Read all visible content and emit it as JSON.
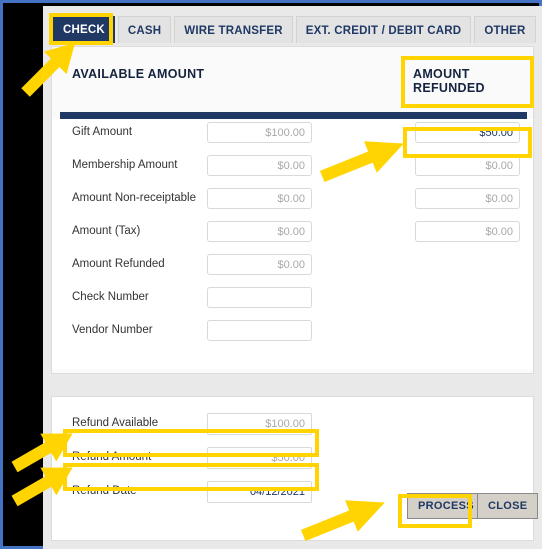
{
  "window": {
    "frame_color": "#4472c4",
    "highlight_color": "#ffd400",
    "accent_color": "#1f3864"
  },
  "tabs": [
    {
      "label": "CHECK",
      "active": true,
      "highlighted": true
    },
    {
      "label": "CASH",
      "active": false,
      "highlighted": false
    },
    {
      "label": "WIRE TRANSFER",
      "active": false,
      "highlighted": false
    },
    {
      "label": "EXT. CREDIT / DEBIT CARD",
      "active": false,
      "highlighted": false
    },
    {
      "label": "OTHER",
      "active": false,
      "highlighted": false
    }
  ],
  "headings": {
    "available_amount": "AVAILABLE AMOUNT",
    "amount_refunded": "AMOUNT REFUNDED"
  },
  "fields": [
    {
      "label": "Gift Amount",
      "available": "$100.00",
      "refunded": "$50.00"
    },
    {
      "label": "Membership Amount",
      "available": "$0.00",
      "refunded": "$0.00"
    },
    {
      "label": "Amount Non-receiptable",
      "available": "$0.00",
      "refunded": "$0.00"
    },
    {
      "label": "Amount (Tax)",
      "available": "$0.00",
      "refunded": "$0.00"
    },
    {
      "label": "Amount Refunded",
      "available": "$0.00",
      "refunded": ""
    },
    {
      "label": "Check Number",
      "available": "",
      "refunded": ""
    },
    {
      "label": "Vendor Number",
      "available": "",
      "refunded": ""
    }
  ],
  "refund": {
    "available_label": "Refund Available",
    "available_value": "$100.00",
    "amount_label": "Refund Amount",
    "amount_value": "$50.00",
    "date_label": "Refund Date",
    "date_value": "04/12/2021"
  },
  "buttons": {
    "process": "PROCESS",
    "close": "CLOSE"
  },
  "annotations": {
    "arrow_check_tab": "arrow-pointing-to-check-tab",
    "arrow_refunded_field": "arrow-pointing-to-gift-amount-refunded",
    "arrow_refund_available": "arrow-pointing-to-refund-available",
    "arrow_refund_amount": "arrow-pointing-to-refund-amount",
    "arrow_process": "arrow-pointing-to-process-button"
  }
}
